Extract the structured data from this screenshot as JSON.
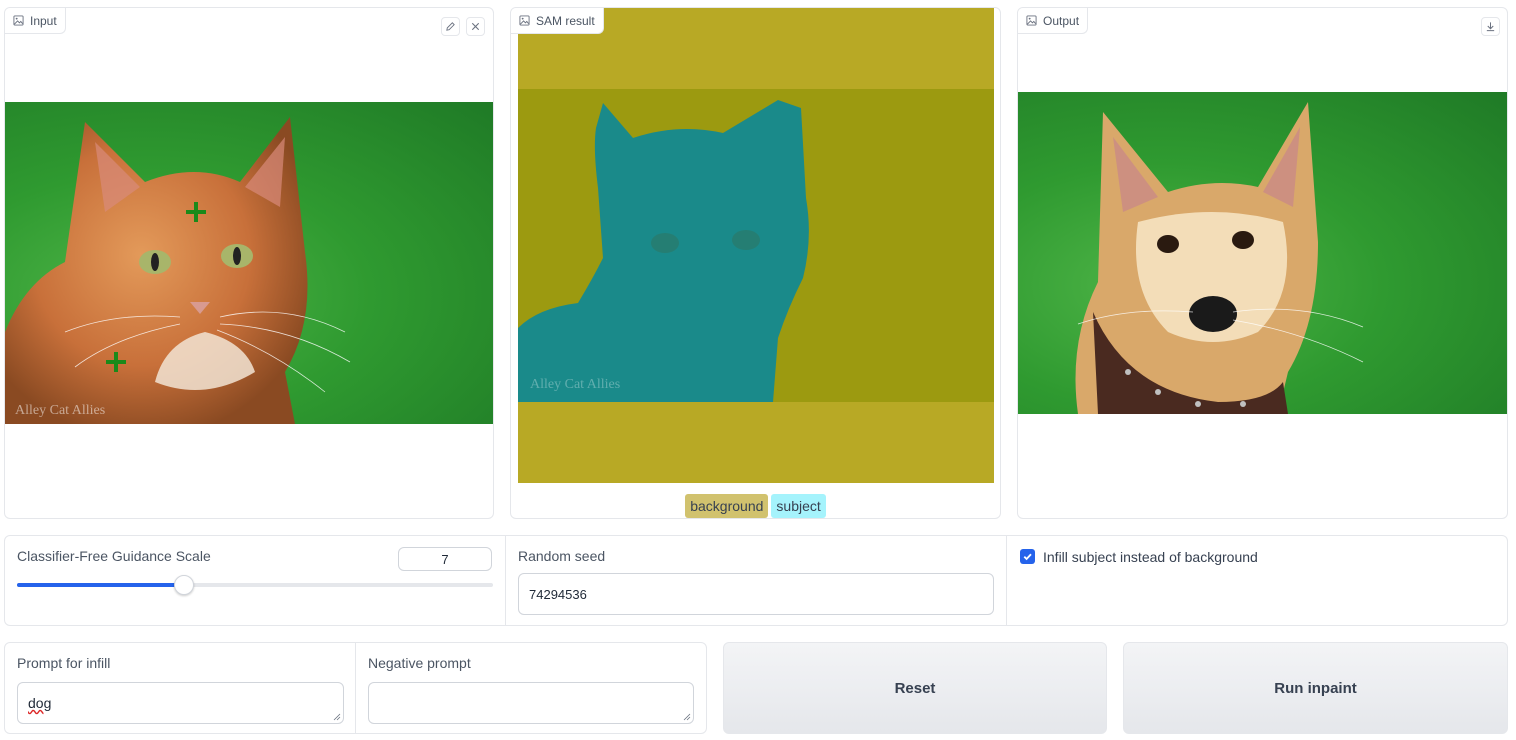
{
  "input_panel": {
    "label": "Input",
    "watermark": "Alley Cat Allies"
  },
  "sam_panel": {
    "label": "SAM result",
    "watermark": "Alley Cat Allies",
    "legend": [
      {
        "label": "background",
        "color": "#d1c26e"
      },
      {
        "label": "subject",
        "color": "#a5f3fc"
      }
    ],
    "mask_colors": {
      "background": "#b8a925",
      "subject": "#1a8a8a"
    }
  },
  "output_panel": {
    "label": "Output"
  },
  "guidance": {
    "label": "Classifier-Free Guidance Scale",
    "value": "7",
    "fraction": 0.35
  },
  "seed": {
    "label": "Random seed",
    "value": "74294536"
  },
  "infill_toggle": {
    "label": "Infill subject instead of background",
    "checked": true
  },
  "prompt": {
    "label": "Prompt for infill",
    "value": "dog"
  },
  "negative_prompt": {
    "label": "Negative prompt",
    "value": ""
  },
  "buttons": {
    "reset": "Reset",
    "run": "Run inpaint"
  },
  "colors": {
    "accent": "#2563eb",
    "grass": "#2f9a30"
  }
}
